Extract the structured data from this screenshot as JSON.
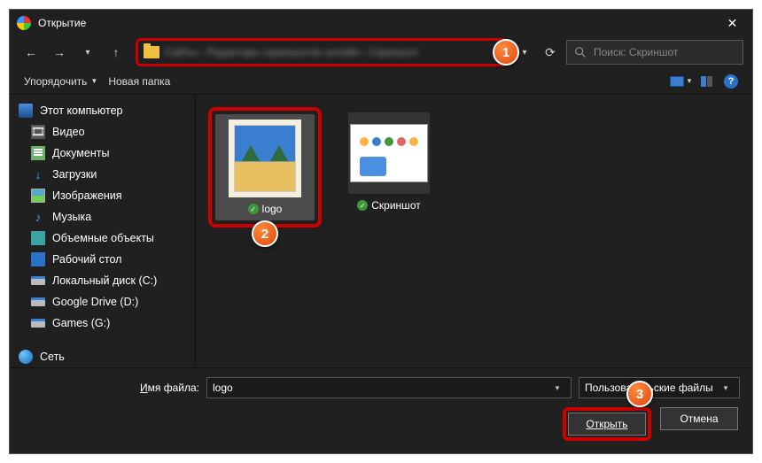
{
  "window": {
    "title": "Открытие"
  },
  "nav": {
    "address_blur": "Сайты  ›  Редакторы скриншотов онлайн  ›  Скриншот",
    "search_placeholder": "Поиск: Скриншот"
  },
  "toolbar": {
    "organize": "Упорядочить",
    "new_folder": "Новая папка"
  },
  "tree": {
    "this_pc": "Этот компьютер",
    "videos": "Видео",
    "documents": "Документы",
    "downloads": "Загрузки",
    "pictures": "Изображения",
    "music": "Музыка",
    "objects3d": "Объемные объекты",
    "desktop": "Рабочий стол",
    "local_c": "Локальный диск (C:)",
    "gdrive": "Google Drive (D:)",
    "games": "Games (G:)",
    "network": "Сеть"
  },
  "files": {
    "f1": "logo",
    "f2": "Скриншот"
  },
  "bottom": {
    "fname_label": "Имя файла:",
    "fname_value": "logo",
    "filter": "Пользовательские файлы",
    "open": "Открыть",
    "cancel": "Отмена"
  },
  "badges": {
    "b1": "1",
    "b2": "2",
    "b3": "3"
  },
  "colors": {
    "highlight": "#c00",
    "badge": "#e0470f"
  }
}
